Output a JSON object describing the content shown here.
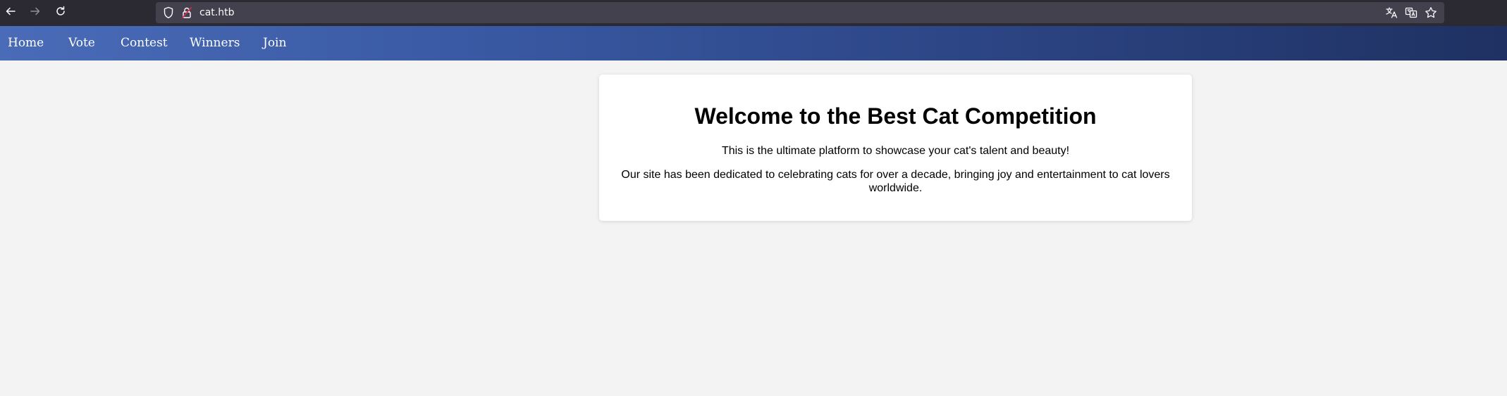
{
  "browser": {
    "url": "cat.htb",
    "icons": [
      "back-arrow-icon",
      "forward-arrow-icon",
      "reload-icon",
      "shield-icon",
      "insecure-lock-icon",
      "translate-icon",
      "reader-translate-icon",
      "bookmark-star-icon"
    ]
  },
  "nav": {
    "items": [
      {
        "label": "Home"
      },
      {
        "label": "Vote"
      },
      {
        "label": "Contest"
      },
      {
        "label": "Winners"
      },
      {
        "label": "Join"
      }
    ],
    "gradient_start": "#4a6bb7",
    "gradient_end": "#1f3162"
  },
  "main": {
    "title": "Welcome to the Best Cat Competition",
    "intro": "This is the ultimate platform to showcase your cat's talent and beauty!",
    "description": "Our site has been dedicated to celebrating cats for over a decade, bringing joy and entertainment to cat lovers worldwide."
  }
}
